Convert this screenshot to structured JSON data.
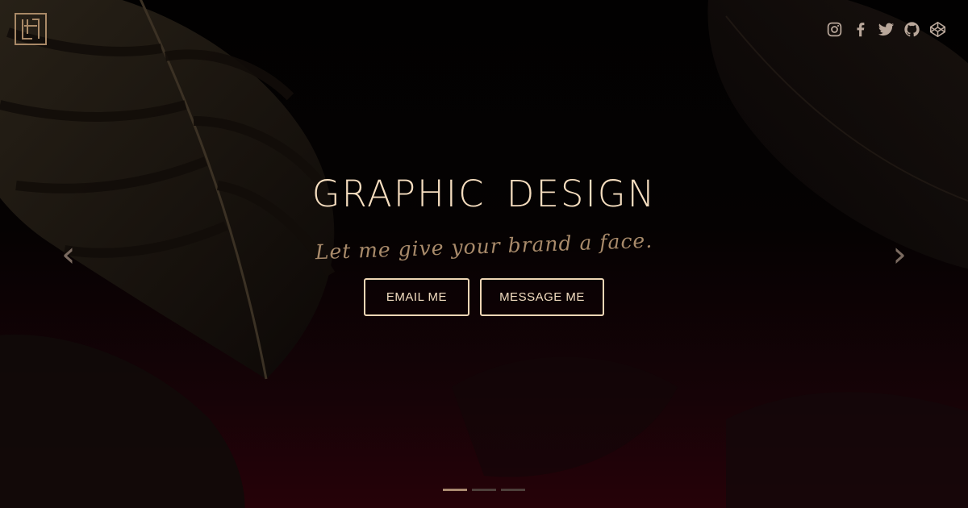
{
  "brand": {
    "logo_icon": "monogram-logo-icon"
  },
  "social_links": [
    {
      "name": "instagram-icon"
    },
    {
      "name": "facebook-icon"
    },
    {
      "name": "twitter-icon"
    },
    {
      "name": "github-icon"
    },
    {
      "name": "codepen-icon"
    }
  ],
  "carousel": {
    "prev_arrow": "‹",
    "next_arrow": "›",
    "slides": 3,
    "active_slide": 1
  },
  "hero": {
    "title": "GRAPHIC  DESIGN",
    "tagline": "Let me give your brand a face.",
    "email_button": "EMAIL  ME",
    "message_button": "MESSAGE  ME"
  },
  "colors": {
    "accent": "#f5ddbf",
    "tagline": "#a88a6a",
    "background_top": "#020101",
    "background_bottom": "#260208"
  }
}
